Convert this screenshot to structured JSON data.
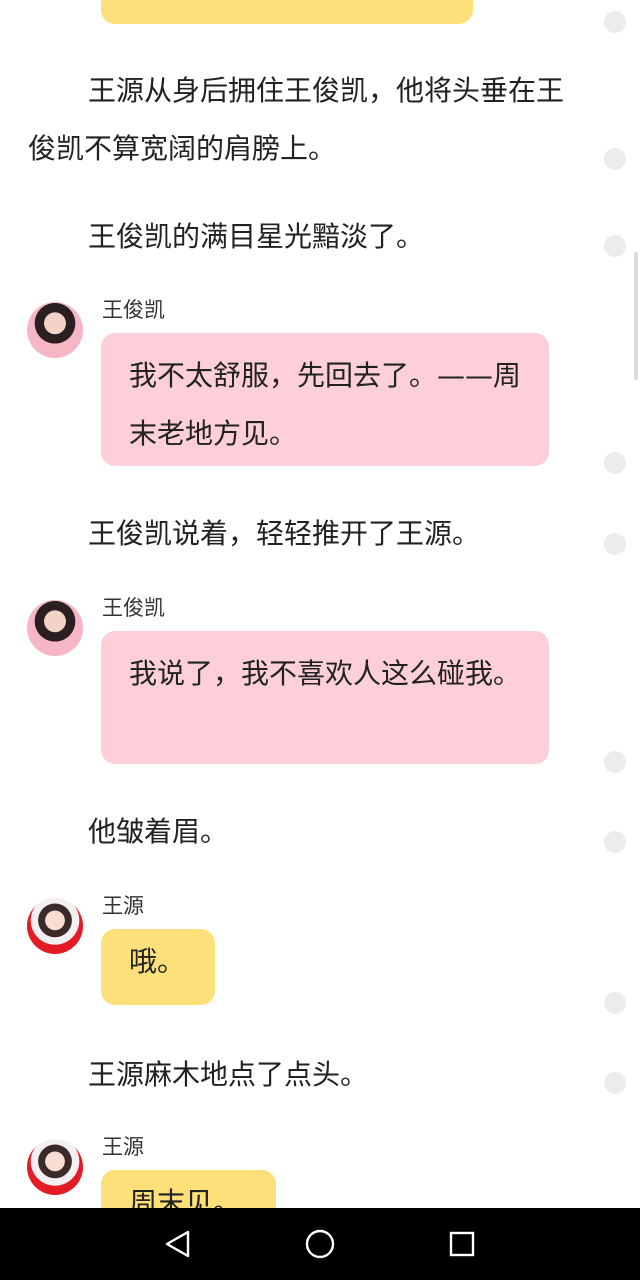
{
  "story": {
    "narration_1": "王源从身后拥住王俊凯，他将头垂在王俊凯不算宽阔的肩膀上。",
    "narration_2": "王俊凯的满目星光黯淡了。",
    "narration_3": "王俊凯说着，轻轻推开了王源。",
    "narration_4": "他皱着眉。",
    "narration_5": "王源麻木地点了点头。",
    "messages": [
      {
        "speaker": "王俊凯",
        "text": "我不太舒服，先回去了。——周末老地方见。"
      },
      {
        "speaker": "王俊凯",
        "text": "我说了，我不喜欢人这么碰我。"
      },
      {
        "speaker": "王源",
        "text": "哦。"
      },
      {
        "speaker": "王源",
        "text": "周末见。"
      }
    ]
  },
  "colors": {
    "pink_bubble": "#fdd0d9",
    "yellow_bubble": "#fde07a",
    "navbar": "#000000"
  },
  "icons": {
    "nav_back": "back-triangle-icon",
    "nav_home": "home-circle-icon",
    "nav_recent": "recent-square-icon"
  }
}
